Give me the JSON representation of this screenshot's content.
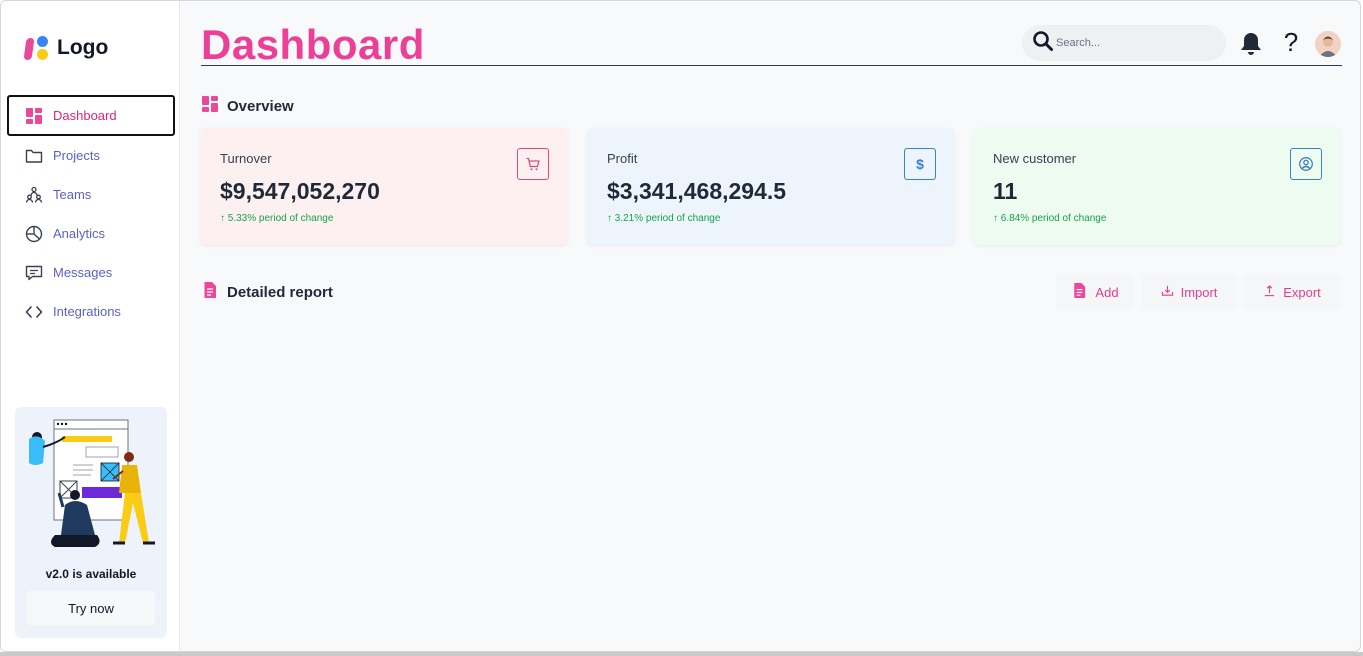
{
  "brand": {
    "logo_text": "Logo"
  },
  "sidebar": {
    "items": [
      {
        "label": "Dashboard",
        "icon": "dashboard-icon",
        "active": true
      },
      {
        "label": "Projects",
        "icon": "folder-icon"
      },
      {
        "label": "Teams",
        "icon": "teams-icon"
      },
      {
        "label": "Analytics",
        "icon": "pie-chart-icon"
      },
      {
        "label": "Messages",
        "icon": "message-icon"
      },
      {
        "label": "Integrations",
        "icon": "code-icon"
      }
    ],
    "promo": {
      "title": "v2.0 is available",
      "button": "Try now"
    }
  },
  "header": {
    "title": "Dashboard",
    "search_placeholder": "Search...",
    "help_glyph": "?"
  },
  "overview": {
    "title": "Overview",
    "cards": [
      {
        "label": "Turnover",
        "value": "$9,547,052,270",
        "change": "↑ 5.33% period of change",
        "icon": "cart-icon",
        "accent": "#e2487f",
        "bg": "#fdf0f1"
      },
      {
        "label": "Profit",
        "value": "$3,341,468,294.5",
        "change": "↑ 3.21% period of change",
        "icon": "dollar-icon",
        "icon_glyph": "$",
        "accent": "#3b82c4",
        "bg": "#eef4fc"
      },
      {
        "label": "New customer",
        "value": "11",
        "change": "↑ 6.84% period of change",
        "icon": "user-circle-icon",
        "accent": "#3b82c4",
        "bg": "#eefbf1"
      }
    ]
  },
  "report": {
    "title": "Detailed report",
    "actions": {
      "add": "Add",
      "import": "Import",
      "export": "Export"
    }
  },
  "colors": {
    "brand_pink": "#ec3f97",
    "nav_text": "#5b61c9",
    "positive": "#16a34a"
  }
}
